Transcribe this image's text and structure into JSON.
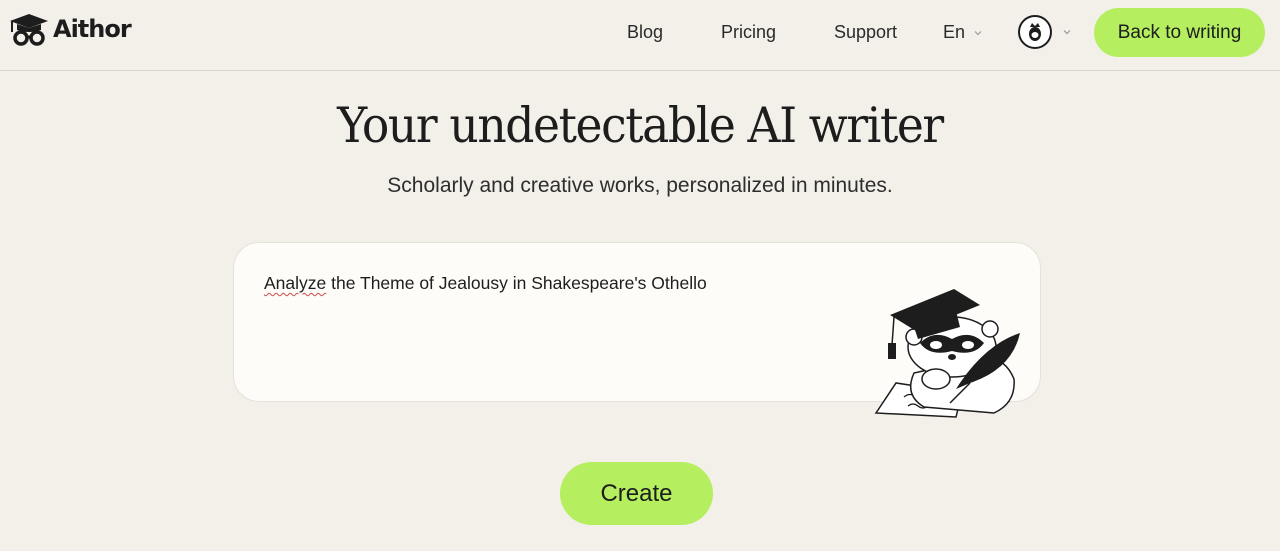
{
  "header": {
    "logo_text": "Aithor",
    "nav": {
      "blog": "Blog",
      "pricing": "Pricing",
      "support": "Support"
    },
    "language": "En",
    "back_button": "Back to writing"
  },
  "hero": {
    "title": "Your undetectable AI writer",
    "subtitle": "Scholarly and creative works, personalized in minutes."
  },
  "prompt": {
    "first_word": "Analyze",
    "rest": " the Theme of Jealousy in Shakespeare's Othello"
  },
  "create_button": "Create",
  "icons": {
    "logo": "graduation-cap-glasses-icon",
    "avatar": "crowned-avatar-icon",
    "chevron": "chevron-down-icon",
    "mascot": "raccoon-scholar-illustration"
  },
  "colors": {
    "background": "#f3efe9",
    "accent": "#b5ef5f",
    "card": "#fdfcf8"
  }
}
